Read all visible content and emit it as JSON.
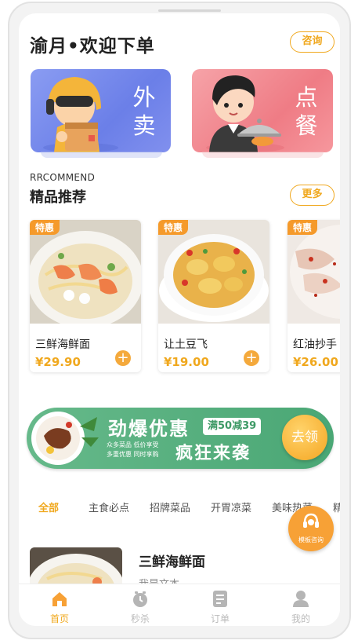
{
  "header": {
    "title": "渝月•欢迎下单",
    "consult_label": "咨询"
  },
  "banners": [
    {
      "name": "takeout",
      "word_top": "外",
      "word_bottom": "卖",
      "color": "#7589ec"
    },
    {
      "name": "order",
      "word_top": "点",
      "word_bottom": "餐",
      "color": "#f18b93"
    }
  ],
  "recommend": {
    "en_label": "RRCOMMEND",
    "cn_label": "精品推荐",
    "more_label": "更多"
  },
  "dishes": [
    {
      "tag": "特惠",
      "name": "三鲜海鲜面",
      "price": "¥29.90"
    },
    {
      "tag": "特惠",
      "name": "让土豆飞",
      "price": "¥19.00"
    },
    {
      "tag": "特惠",
      "name": "红油抄手",
      "price": "¥26.00"
    }
  ],
  "promo": {
    "headline": "劲爆优惠",
    "badge": "满50减39",
    "line1": "众多菜品 低价享受",
    "line2": "多重优惠 同时享购",
    "slogan": "疯狂来袭",
    "cta": "去领"
  },
  "category_tabs": [
    "全部",
    "主食必点",
    "招牌菜品",
    "开胃凉菜",
    "美味热菜",
    "精"
  ],
  "active_tab": "全部",
  "list_item": {
    "name": "三鲜海鲜面",
    "desc": "我是文本"
  },
  "floating_button": {
    "label": "模板咨询"
  },
  "tabbar": [
    {
      "label": "首页",
      "icon": "home-icon"
    },
    {
      "label": "秒杀",
      "icon": "clock-icon"
    },
    {
      "label": "订单",
      "icon": "order-icon"
    },
    {
      "label": "我的",
      "icon": "user-icon"
    }
  ],
  "colors": {
    "accent": "#f0a81e",
    "promo_green": "#4aa775",
    "banner_blue": "#7589ec",
    "banner_pink": "#f18b93"
  }
}
